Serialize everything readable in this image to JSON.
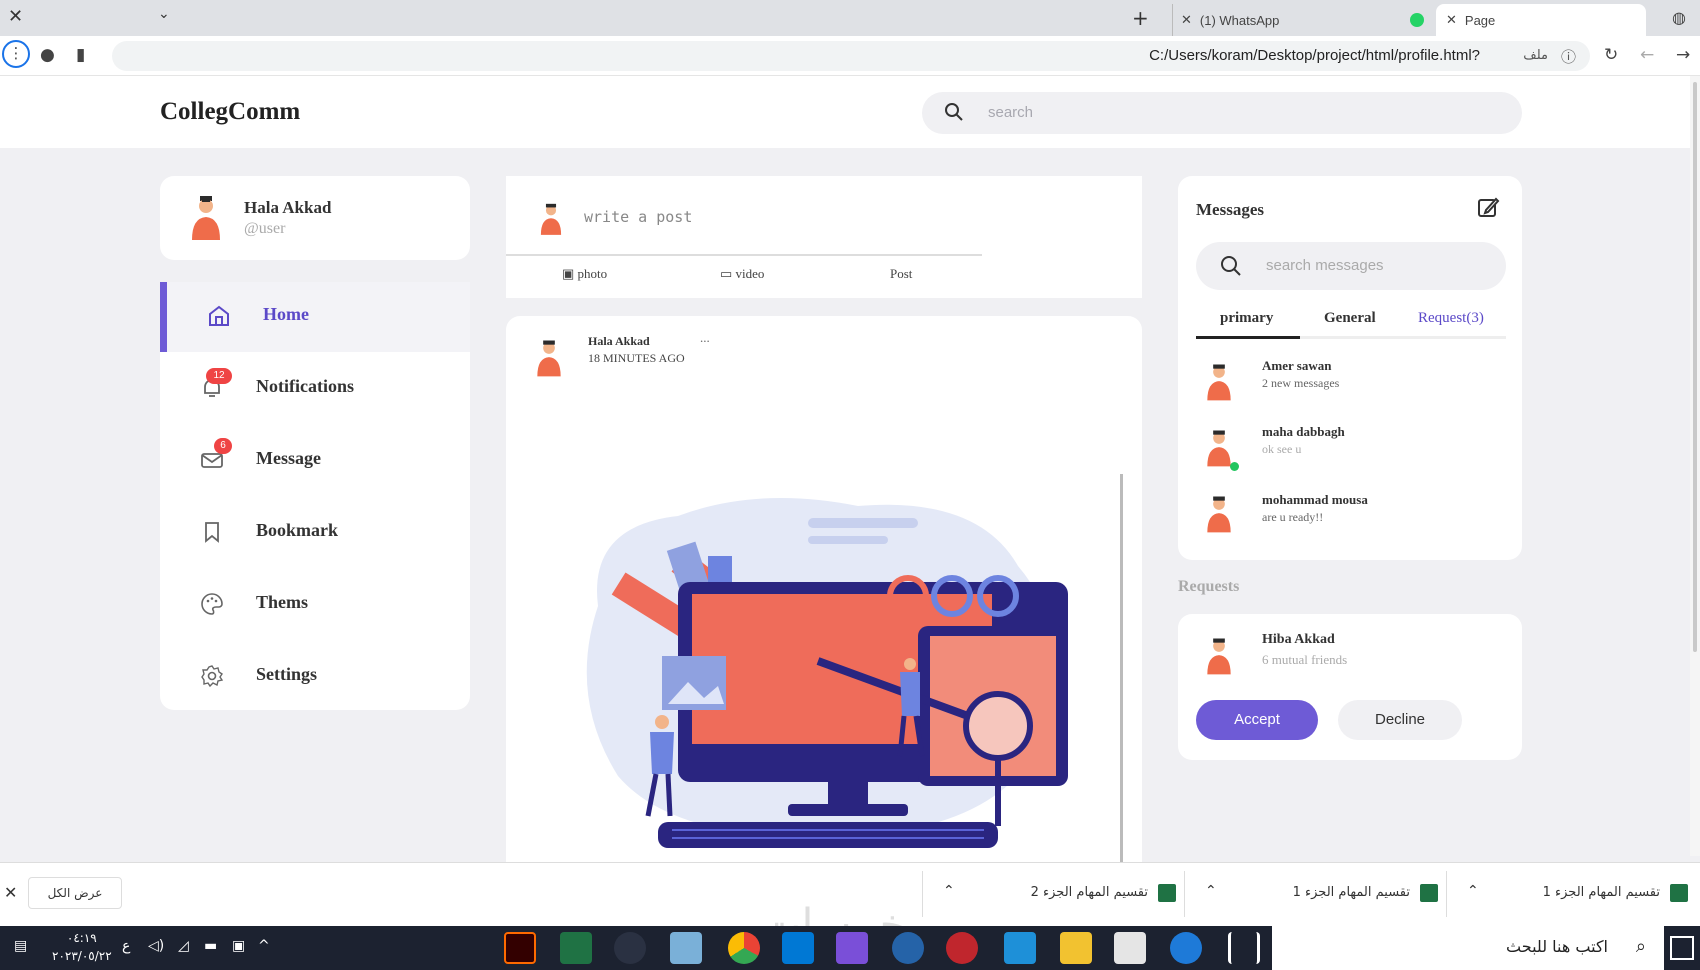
{
  "browser": {
    "tabs": [
      {
        "label": "(1) WhatsApp"
      },
      {
        "label": "Page"
      }
    ],
    "url": "C:/Users/koram/Desktop/project/html/profile.html?",
    "url_prefix": "ملف"
  },
  "app": {
    "logo": "CollegComm",
    "search_placeholder": "search"
  },
  "profile": {
    "name": "Hala Akkad",
    "handle": "@user"
  },
  "nav": {
    "items": [
      {
        "label": "Home",
        "active": true
      },
      {
        "label": "Notifications",
        "badge": "12"
      },
      {
        "label": "Message",
        "badge": "6"
      },
      {
        "label": "Bookmark"
      },
      {
        "label": "Thems"
      },
      {
        "label": "Settings"
      }
    ]
  },
  "composer": {
    "placeholder": "write a post",
    "actions": [
      "photo",
      "video",
      "Post"
    ]
  },
  "post": {
    "author": "Hala Akkad",
    "time": "18 MINUTES AGO",
    "more": "..."
  },
  "messages": {
    "title": "Messages",
    "search_placeholder": "search messages",
    "tabs": [
      "primary",
      "General",
      "Request(3)"
    ],
    "contacts": [
      {
        "name": "Amer sawan",
        "sub": "2 new messages",
        "online": false
      },
      {
        "name": "maha dabbagh",
        "sub": "ok see u",
        "online": true
      },
      {
        "name": "mohammad mousa",
        "sub": "are u ready!!",
        "online": false
      }
    ]
  },
  "requests": {
    "label": "Requests",
    "name": "Hiba Akkad",
    "sub": "6 mutual friends",
    "accept": "Accept",
    "decline": "Decline"
  },
  "downloads": {
    "show_all": "عرض الكل",
    "items": [
      "تقسيم المهام الجزء 1",
      "تقسيم المهام الجزء 1",
      "تقسيم المهام الجزء 2"
    ]
  },
  "taskbar": {
    "time": "٠٤:١٩",
    "date": "٢٠٢٣/٠٥/٢٢",
    "lang": "ع",
    "search_placeholder": "اكتب هنا للبحث"
  },
  "watermark": "خمسات",
  "colors": {
    "accent": "#6e5bd6",
    "badge": "#ef4444",
    "online": "#22c55e"
  }
}
